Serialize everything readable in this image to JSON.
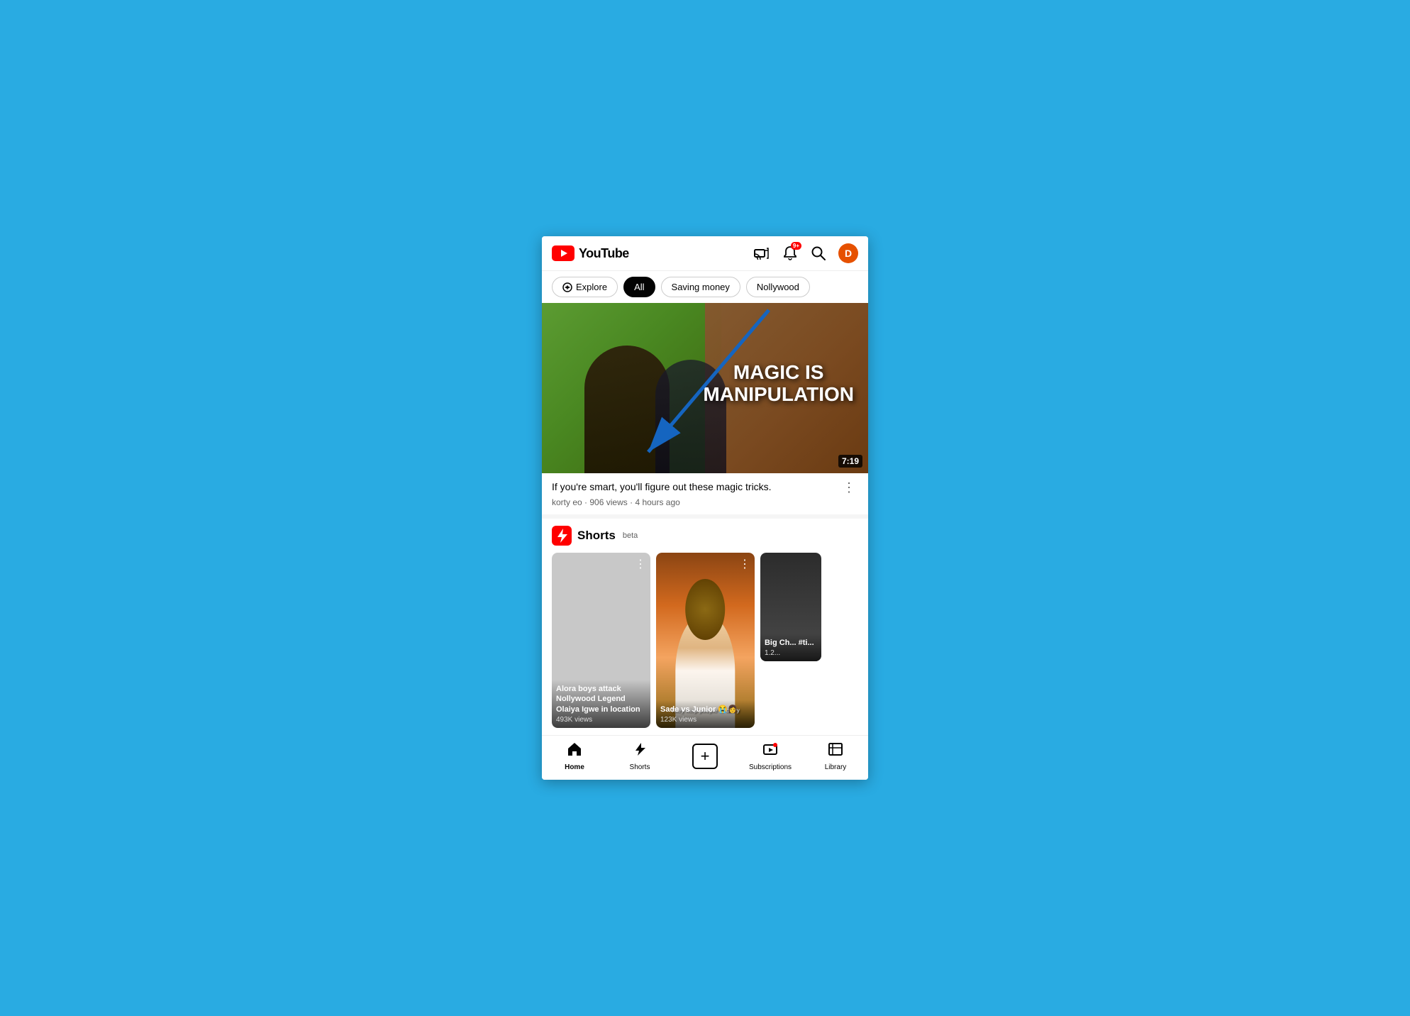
{
  "app": {
    "name": "YouTube",
    "logo_alt": "YouTube"
  },
  "header": {
    "cast_icon": "cast",
    "notification_icon": "bell",
    "notification_count": "9+",
    "search_icon": "search",
    "avatar_letter": "D",
    "avatar_color": "#E65100"
  },
  "filter_chips": [
    {
      "id": "explore",
      "label": "Explore",
      "active": false,
      "has_icon": true
    },
    {
      "id": "all",
      "label": "All",
      "active": true,
      "has_icon": false
    },
    {
      "id": "saving_money",
      "label": "Saving money",
      "active": false,
      "has_icon": false
    },
    {
      "id": "nollywood",
      "label": "Nollywood",
      "active": false,
      "has_icon": false
    }
  ],
  "main_video": {
    "title": "If you're smart, you'll figure out these magic tricks.",
    "channel": "korty eo",
    "views": "906 views",
    "time_ago": "4 hours ago",
    "duration": "7:19",
    "overlay_text_line1": "MAGIC IS",
    "overlay_text_line2": "MANIPULATION"
  },
  "shorts_section": {
    "label": "Shorts",
    "beta_label": "beta",
    "shorts": [
      {
        "id": 1,
        "title": "Alora boys attack Nollywood Legend Olaiya Igwe in location",
        "views": "493K views",
        "has_thumb": false
      },
      {
        "id": 2,
        "title": "Sade vs Junior 😭👩",
        "views": "123K views",
        "has_thumb": true,
        "helper_text": "They help people to carry"
      },
      {
        "id": 3,
        "title": "Big Ch... #ti...",
        "views": "1.2...",
        "has_thumb": true,
        "partial": true
      }
    ]
  },
  "bottom_nav": [
    {
      "id": "home",
      "label": "Home",
      "icon": "home",
      "active": true
    },
    {
      "id": "shorts",
      "label": "Shorts",
      "icon": "shorts",
      "active": false
    },
    {
      "id": "add",
      "label": "",
      "icon": "plus",
      "active": false
    },
    {
      "id": "subscriptions",
      "label": "Subscriptions",
      "icon": "subscriptions",
      "active": false,
      "has_badge": true
    },
    {
      "id": "library",
      "label": "Library",
      "icon": "library",
      "active": false
    }
  ]
}
